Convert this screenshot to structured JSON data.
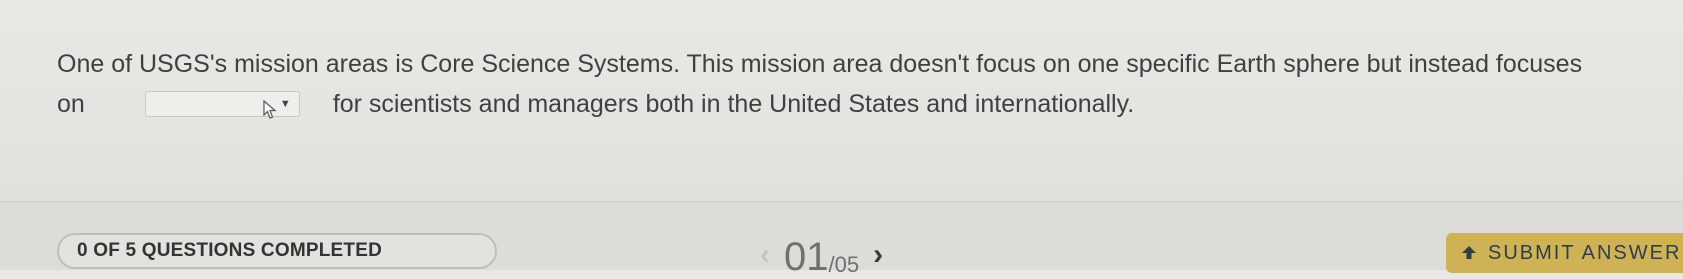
{
  "question": {
    "line1": "One of USGS's mission areas is Core Science Systems. This mission area doesn't focus on one specific Earth sphere but instead focuses",
    "line2_prefix": "on",
    "line2_suffix": "for scientists and managers both in the United States and internationally.",
    "dropdown_value": "",
    "dropdown_caret": "▼"
  },
  "footer": {
    "progress_text": "0 OF 5 QUESTIONS COMPLETED",
    "pager": {
      "prev_icon": "‹",
      "current": "01",
      "total": "/05",
      "next_icon": "›"
    },
    "submit_label": "SUBMIT ANSWER"
  }
}
